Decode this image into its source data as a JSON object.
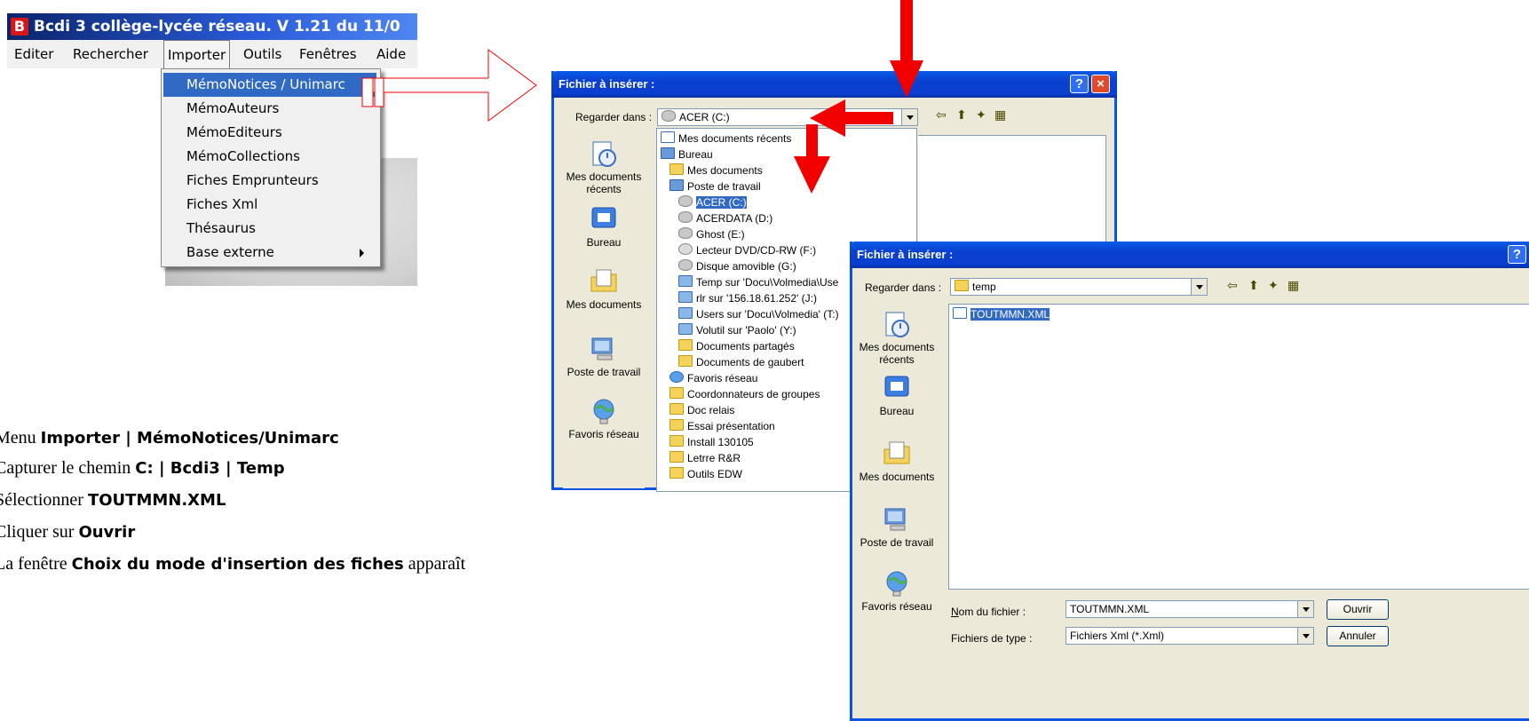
{
  "app": {
    "title": "Bcdi 3 collège-lycée réseau. V 1.21 du 11/0",
    "logo": "B",
    "menu": [
      "Editer",
      "Rechercher",
      "Importer",
      "Outils",
      "Fenêtres",
      "Aide"
    ],
    "dropdown": [
      "MémoNotices / Unimarc",
      "MémoAuteurs",
      "MémoEditeurs",
      "MémoCollections",
      "Fiches Emprunteurs",
      "Fiches Xml",
      "Thésaurus",
      "Base externe"
    ]
  },
  "instructions": [
    {
      "pre": "Menu ",
      "bold": "Importer | MémoNotices/Unimarc",
      "post": ""
    },
    {
      "pre": "Capturer le chemin ",
      "bold": "C: | Bcdi3 | Temp",
      "post": ""
    },
    {
      "pre": "Sélectionner ",
      "bold": "TOUTMMN.XML",
      "post": ""
    },
    {
      "pre": "Cliquer sur ",
      "bold": "Ouvrir",
      "post": ""
    },
    {
      "pre": "La fenêtre ",
      "bold": "Choix du mode d'insertion des fiches",
      "post": " apparaît"
    }
  ],
  "dialog1": {
    "title": "Fichier à insérer :",
    "look_in_label": "Regarder dans :",
    "look_in_value": "ACER (C:)",
    "places": [
      "Mes documents récents",
      "Bureau",
      "Mes documents",
      "Poste de travail",
      "Favoris réseau"
    ],
    "tree": [
      {
        "label": "Mes documents récents",
        "icon": "doc"
      },
      {
        "label": "Bureau",
        "icon": "pc"
      },
      {
        "label": "Mes documents",
        "icon": "folder"
      },
      {
        "label": "Poste de travail",
        "icon": "pc"
      },
      {
        "label": "ACER (C:)",
        "icon": "drive",
        "selected": true
      },
      {
        "label": "ACERDATA (D:)",
        "icon": "drive"
      },
      {
        "label": "Ghost (E:)",
        "icon": "drive"
      },
      {
        "label": "Lecteur DVD/CD-RW (F:)",
        "icon": "cd"
      },
      {
        "label": "Disque amovible (G:)",
        "icon": "drive"
      },
      {
        "label": "Temp sur 'Docu\\Volmedia\\Use",
        "icon": "net"
      },
      {
        "label": "rlr sur '156.18.61.252' (J:)",
        "icon": "net"
      },
      {
        "label": "Users sur 'Docu\\Volmedia' (T:)",
        "icon": "net"
      },
      {
        "label": "Volutil sur 'Paolo' (Y:)",
        "icon": "net"
      },
      {
        "label": "Documents partagés",
        "icon": "folder"
      },
      {
        "label": "Documents de gaubert",
        "icon": "folder"
      },
      {
        "label": "Favoris réseau",
        "icon": "fav"
      },
      {
        "label": "Coordonnateurs de groupes",
        "icon": "folder"
      },
      {
        "label": "Doc relais",
        "icon": "folder"
      },
      {
        "label": "Essai présentation",
        "icon": "folder"
      },
      {
        "label": "Install 130105",
        "icon": "folder"
      },
      {
        "label": "Letrre R&R",
        "icon": "folder"
      },
      {
        "label": "Outils EDW",
        "icon": "folder"
      }
    ]
  },
  "dialog2": {
    "title": "Fichier à insérer :",
    "look_in_label": "Regarder dans :",
    "look_in_value": "temp",
    "places": [
      "Mes documents récents",
      "Bureau",
      "Mes documents",
      "Poste de travail",
      "Favoris réseau"
    ],
    "file": "TOUTMMN.XML",
    "filename_label": "Nom du fichier :",
    "filename_value": "TOUTMMN.XML",
    "filetype_label": "Fichiers de type :",
    "filetype_value": "Fichiers Xml (*.Xml)",
    "open_button": "Ouvrir",
    "cancel_button": "Annuler"
  },
  "colors": {
    "arrow": "#f20000",
    "xp_blue": "#0a54e3",
    "selection": "#316ac5"
  }
}
